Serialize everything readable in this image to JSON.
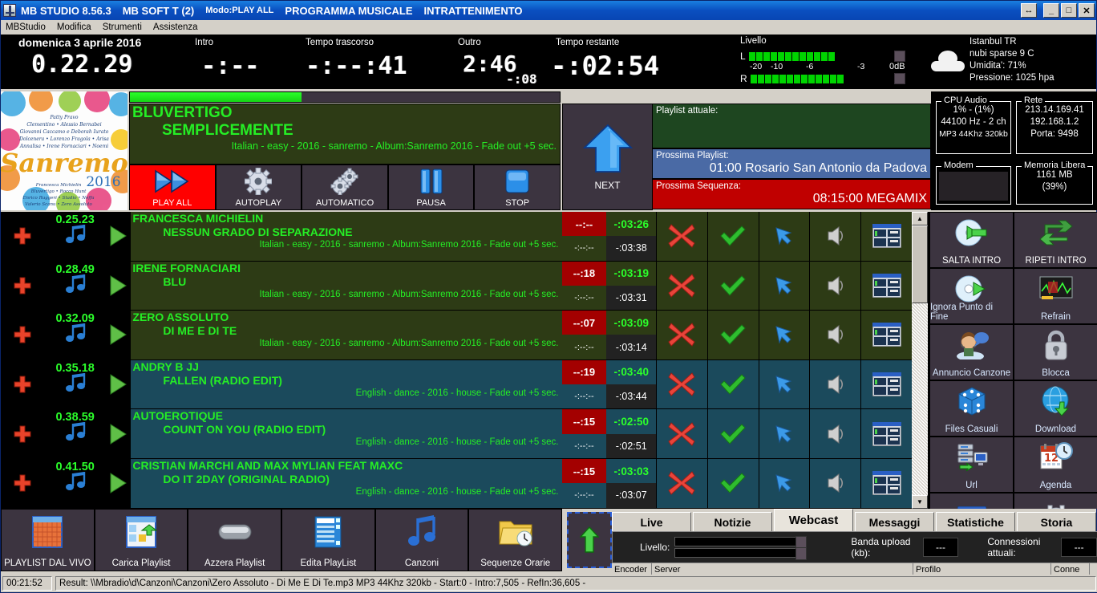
{
  "titlebar": {
    "app": "MB STUDIO  8.56.3",
    "license": "MB SOFT T (2)",
    "mode": "Modo:PLAY ALL",
    "program": "PROGRAMMA MUSICALE",
    "category": "INTRATTENIMENTO",
    "buttons": {
      "resize": "↔",
      "minimize": "_",
      "maximize": "□",
      "close": "✕"
    }
  },
  "menubar": {
    "items": [
      "MBStudio",
      "Modifica",
      "Strumenti",
      "Assistenza"
    ]
  },
  "clocks": {
    "date": "domenica 3 aprile 2016",
    "time": "0.22.29",
    "intro": {
      "label": "Intro",
      "value": "-:--"
    },
    "elapsed": {
      "label": "Tempo trascorso",
      "value": "-:--:41"
    },
    "outro": {
      "label": "Outro",
      "value": "2:46",
      "sub": "-:08"
    },
    "remaining": {
      "label": "Tempo restante",
      "value": "-:02:54"
    }
  },
  "level": {
    "label": "Livello",
    "left_channel": "L",
    "right_channel": "R",
    "scale": [
      "-20",
      "-10",
      "-6",
      "-3"
    ],
    "zero_label": "0dB",
    "left_leds": 12,
    "right_leds": 13,
    "led_color": "#00d400"
  },
  "weather": {
    "city": "Istanbul TR",
    "condition": "nubi sparse 9 C",
    "humidity": "Umidita': 71%",
    "pressure": "Pressione: 1025 hpa",
    "icon": "cloud-icon"
  },
  "now_playing": {
    "artist": "BLUVERTIGO",
    "title": "SEMPLICEMENTE",
    "info": "Italian - easy - 2016 - sanremo - Album:Sanremo 2016 - Fade out +5 sec.",
    "progress_percent": 40,
    "album_art_alt": "Sanremo 2016"
  },
  "transport": [
    {
      "label": "PLAY ALL",
      "icon": "play-all-icon",
      "active": true
    },
    {
      "label": "AUTOPLAY",
      "icon": "gear-icon",
      "active": false
    },
    {
      "label": "AUTOMATICO",
      "icon": "gears-icon",
      "active": false
    },
    {
      "label": "PAUSA",
      "icon": "pause-icon",
      "active": false
    },
    {
      "label": "STOP",
      "icon": "stop-icon",
      "active": false
    }
  ],
  "next_button": {
    "label": "NEXT",
    "icon": "up-arrow-icon"
  },
  "playlist_panel": {
    "current_label": "Playlist attuale:",
    "current_value": "",
    "next_label": "Prossima Playlist:",
    "next_value": "01:00 Rosario San Antonio da Padova",
    "sequence_label": "Prossima Sequenza:",
    "sequence_value": "08:15:00 MEGAMIX"
  },
  "info_boxes": {
    "cpu": {
      "legend": "CPU Audio",
      "lines": [
        "1% - (1%)",
        "44100 Hz - 2 ch",
        "MP3 44Khz 320kb"
      ]
    },
    "net": {
      "legend": "Rete",
      "lines": [
        "213.14.169.41",
        "192.168.1.2",
        "Porta: 9498"
      ]
    },
    "modem": {
      "legend": "Modem",
      "lines": []
    },
    "memory": {
      "legend": "Memoria Libera",
      "lines": [
        "1161 MB",
        "(39%)"
      ]
    }
  },
  "playlist": {
    "rows": [
      {
        "start": "0.25.23",
        "artist": "FRANCESCA MICHIELIN",
        "title": "NESSUN GRADO DI SEPARAZIONE",
        "info": "Italian - easy - 2016 - sanremo - Album:Sanremo 2016 - Fade out +5 sec.",
        "intro": "--:--",
        "cue": "-:--:--",
        "remaining": "-:03:26",
        "duration": "-:03:38",
        "theme": "green"
      },
      {
        "start": "0.28.49",
        "artist": "IRENE FORNACIARI",
        "title": "BLU",
        "info": "Italian - easy - 2016 - sanremo - Album:Sanremo 2016 - Fade out +5 sec.",
        "intro": "--:18",
        "cue": "-:--:--",
        "remaining": "-:03:19",
        "duration": "-:03:31",
        "theme": "green"
      },
      {
        "start": "0.32.09",
        "artist": "ZERO ASSOLUTO",
        "title": "DI ME E DI TE",
        "info": "Italian - easy - 2016 - sanremo - Album:Sanremo 2016 - Fade out +5 sec.",
        "intro": "--:07",
        "cue": "-:--:--",
        "remaining": "-:03:09",
        "duration": "-:03:14",
        "theme": "green"
      },
      {
        "start": "0.35.18",
        "artist": "ANDRY B JJ",
        "title": "FALLEN (RADIO EDIT)",
        "info": "English - dance - 2016 - house - Fade out +5 sec.",
        "intro": "--:19",
        "cue": "-:--:--",
        "remaining": "-:03:40",
        "duration": "-:03:44",
        "theme": "blue"
      },
      {
        "start": "0.38.59",
        "artist": "AUTOEROTIQUE",
        "title": "COUNT ON YOU (RADIO EDIT)",
        "info": "English - dance - 2016 - house - Fade out +5 sec.",
        "intro": "--:15",
        "cue": "-:--:--",
        "remaining": "-:02:50",
        "duration": "-:02:51",
        "theme": "blue"
      },
      {
        "start": "0.41.50",
        "artist": "CRISTIAN MARCHI AND MAX MYLIAN FEAT MAXC",
        "title": "DO IT 2DAY (ORIGINAL RADIO)",
        "info": "English - dance - 2016 - house - Fade out +5 sec.",
        "intro": "--:15",
        "cue": "-:--:--",
        "remaining": "-:03:03",
        "duration": "-:03:07",
        "theme": "blue"
      }
    ],
    "row_icons": {
      "add": "plus-icon",
      "note": "music-note-icon",
      "play": "play-triangle-icon",
      "delete": "red-x-icon",
      "confirm": "green-check-icon",
      "move": "blue-arrow-icon",
      "audio": "speaker-icon",
      "properties": "window-preview-icon"
    }
  },
  "sidebar": {
    "items": [
      {
        "label": "SALTA INTRO",
        "icon": "skip-intro-icon",
        "style": "white"
      },
      {
        "label": "RIPETI INTRO",
        "icon": "repeat-intro-icon",
        "style": "white"
      },
      {
        "label": "Ignora Punto di Fine",
        "icon": "ignore-end-icon",
        "style": "blue"
      },
      {
        "label": "Refrain",
        "icon": "refrain-icon",
        "style": "blue"
      },
      {
        "label": "Annuncio Canzone",
        "icon": "announce-icon",
        "style": "blue"
      },
      {
        "label": "Blocca",
        "icon": "lock-icon",
        "style": "blue"
      },
      {
        "label": "Files Casuali",
        "icon": "dice-icon",
        "style": "blue"
      },
      {
        "label": "Download",
        "icon": "download-icon",
        "style": "blue"
      },
      {
        "label": "Url",
        "icon": "server-url-icon",
        "style": "blue"
      },
      {
        "label": "Agenda",
        "icon": "calendar-clock-icon",
        "style": "blue"
      },
      {
        "label": "",
        "icon": "keyboard-icon",
        "style": "blue"
      },
      {
        "label": "",
        "icon": "settings-icon",
        "style": "blue"
      }
    ]
  },
  "bottom_toolbar": {
    "items": [
      {
        "label": "PLAYLIST DAL VIVO",
        "icon": "grid-icon"
      },
      {
        "label": "Carica Playlist",
        "icon": "load-playlist-icon"
      },
      {
        "label": "Azzera Playlist",
        "icon": "clear-playlist-icon"
      },
      {
        "label": "Edita PlayList",
        "icon": "edit-playlist-icon"
      },
      {
        "label": "Canzoni",
        "icon": "music-note-icon"
      },
      {
        "label": "Sequenze Orarie",
        "icon": "folder-clock-icon"
      }
    ],
    "dropzone_icon": "green-up-arrow-icon"
  },
  "tabs": {
    "items": [
      "Live",
      "Notizie",
      "Webcast",
      "Messaggi",
      "Statistiche",
      "Storia"
    ],
    "selected": "Webcast"
  },
  "webcast": {
    "level_label": "Livello:",
    "upload_label": "Banda upload (kb):",
    "upload_value": "---",
    "connections_label": "Connessioni attuali:",
    "connections_value": "---",
    "grid_headers": [
      "Encoder",
      "Server",
      "Profilo",
      "Conne"
    ]
  },
  "statusbar": {
    "elapsed": "00:21:52",
    "result": "Result: \\\\Mbradio\\d\\Canzoni\\Canzoni\\Zero Assoluto - Di Me E Di Te.mp3 MP3 44Khz 320kb - Start:0 - Intro:7,505 - RefIn:36,605 -"
  },
  "colors": {
    "accent_blue": "#0a4fc0",
    "led_green": "#00d400",
    "text_green": "#25ee25",
    "row_green": "#2d3b15",
    "row_blue": "#1b4a5c",
    "alert_red": "#a30000",
    "panel": "#3c3440"
  }
}
